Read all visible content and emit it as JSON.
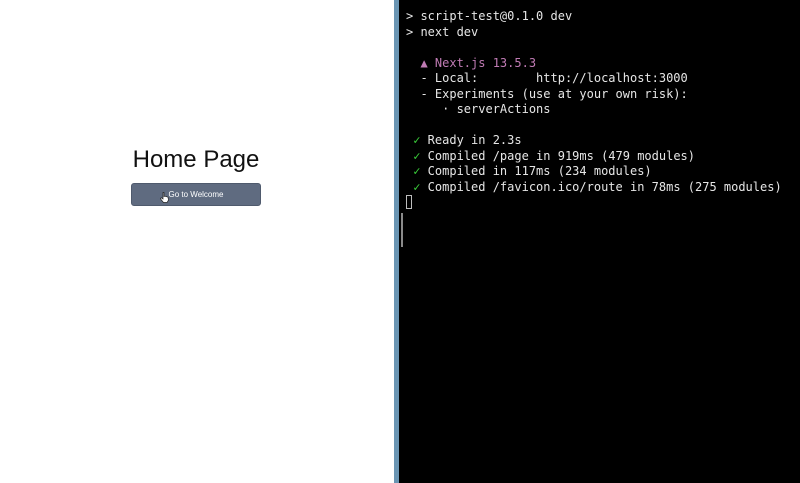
{
  "browser": {
    "page_title": "Home Page",
    "button_label": "Go to Welcome"
  },
  "terminal": {
    "lines": {
      "l1": "> script-test@0.1.0 dev",
      "l2": "> next dev",
      "l3_prefix": "  ",
      "l3": "▲ Next.js 13.5.3",
      "l4": "  - Local:        http://localhost:3000",
      "l5": "  - Experiments (use at your own risk):",
      "l6": "     · serverActions",
      "r1_mark": " ✓",
      "r1": " Ready in 2.3s",
      "r2_mark": " ✓",
      "r2": " Compiled /page in 919ms (479 modules)",
      "r3_mark": " ✓",
      "r3": " Compiled in 117ms (234 modules)",
      "r4_mark": " ✓",
      "r4": " Compiled /favicon.ico/route in 78ms (275 modules)"
    }
  },
  "colors": {
    "terminal_bg": "#000000",
    "terminal_text": "#e6e6e6",
    "nextjs_accent": "#c07bb4",
    "success_green": "#3bd03b",
    "button_bg": "#5f6b80",
    "divider": "#6a95b3"
  },
  "icons": {
    "pointer": "hand-pointer-icon"
  }
}
